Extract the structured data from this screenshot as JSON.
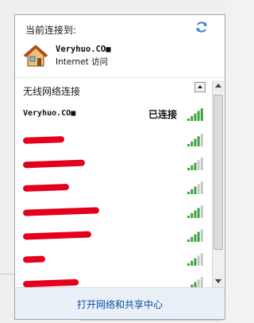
{
  "current_connection": {
    "title": "当前连接到:",
    "name": "Veryhuo.CO■",
    "access": "Internet 访问",
    "icons": {
      "refresh": "refresh-icon",
      "network": "house-icon"
    }
  },
  "wireless": {
    "title": "无线网络连接",
    "networks": [
      {
        "ssid": "Veryhuo.CO■",
        "status": "已连接",
        "signal": 5
      },
      {
        "ssid": "",
        "status": "",
        "signal": 4
      },
      {
        "ssid": "",
        "status": "",
        "signal": 3
      },
      {
        "ssid": "",
        "status": "",
        "signal": 3
      },
      {
        "ssid": "",
        "status": "",
        "signal": 4
      },
      {
        "ssid": "",
        "status": "",
        "signal": 4
      },
      {
        "ssid": "",
        "status": "",
        "signal": 3
      },
      {
        "ssid": "",
        "status": "",
        "signal": 3
      }
    ]
  },
  "footer": {
    "link": "打开网络和共享中心"
  },
  "colors": {
    "signal_on": "#3ea33e",
    "signal_off": "#c7c7c7",
    "link": "#0b4fa3",
    "redaction": "#e3001b"
  }
}
